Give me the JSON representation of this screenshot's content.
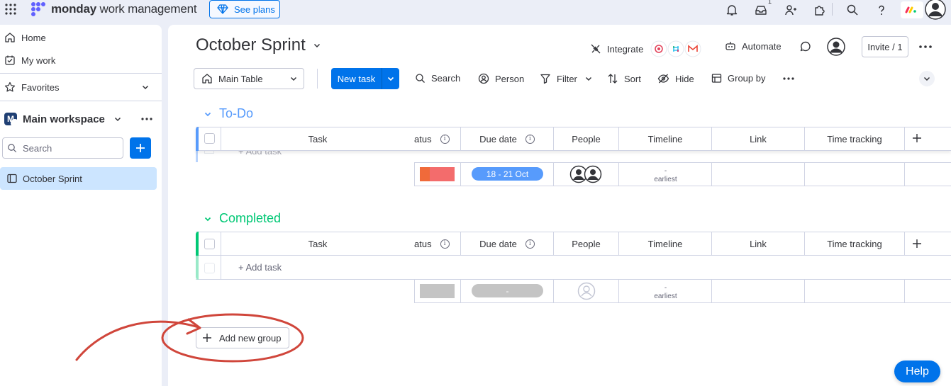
{
  "topbar": {
    "brand_bold": "monday",
    "brand_rest": " work management",
    "see_plans": "See plans",
    "inbox_badge": "1"
  },
  "sidebar": {
    "home": "Home",
    "my_work": "My work",
    "favorites": "Favorites",
    "workspace_initial": "M",
    "workspace_name": "Main workspace",
    "search_placeholder": "Search",
    "board_item": "October Sprint"
  },
  "board": {
    "title": "October Sprint",
    "integrate": "Integrate",
    "automate": "Automate",
    "invite": "Invite / 1"
  },
  "toolbar": {
    "view": "Main Table",
    "new_task": "New task",
    "search": "Search",
    "person": "Person",
    "filter": "Filter",
    "sort": "Sort",
    "hide": "Hide",
    "group_by": "Group by"
  },
  "columns": {
    "task": "Task",
    "status": "atus",
    "due_date": "Due date",
    "people": "People",
    "timeline": "Timeline",
    "link": "Link",
    "time_tracking": "Time tracking"
  },
  "groups": [
    {
      "title": "To-Do",
      "color": "#579bfc",
      "add_task": "+ Add task",
      "summary": {
        "status_color": "#f36c6c",
        "due_date": "18 - 21 Oct",
        "due_color": "#579bfc",
        "timeline_dash": "-",
        "timeline_sub": "earliest"
      }
    },
    {
      "title": "Completed",
      "color": "#00c875",
      "add_task": "+ Add task",
      "summary": {
        "status_color": "#c4c4c4",
        "due_date": "-",
        "due_color": "#c4c4c4",
        "timeline_dash": "-",
        "timeline_sub": "earliest"
      }
    }
  ],
  "add_new_group": "Add new group",
  "help": "Help",
  "colors": {
    "primary": "#0073ea",
    "annotation": "#d0463b"
  }
}
